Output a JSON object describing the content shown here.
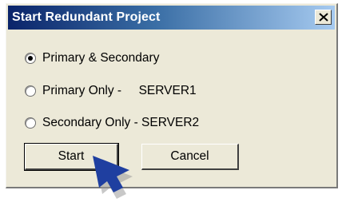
{
  "dialog": {
    "title": "Start Redundant Project",
    "close_label": "×"
  },
  "options": [
    {
      "label": "Primary & Secondary",
      "selected": true
    },
    {
      "label": "Primary Only -     SERVER1",
      "selected": false
    },
    {
      "label": "Secondary Only - SERVER2",
      "selected": false
    }
  ],
  "buttons": {
    "start_label": "Start",
    "cancel_label": "Cancel"
  },
  "colors": {
    "titlebar_start": "#0a246a",
    "titlebar_end": "#a6caf0",
    "dialog_bg": "#ece9d8",
    "cursor_fill": "#1f3fa0"
  },
  "icons": {
    "close": "close-icon",
    "cursor": "mouse-pointer-icon"
  }
}
